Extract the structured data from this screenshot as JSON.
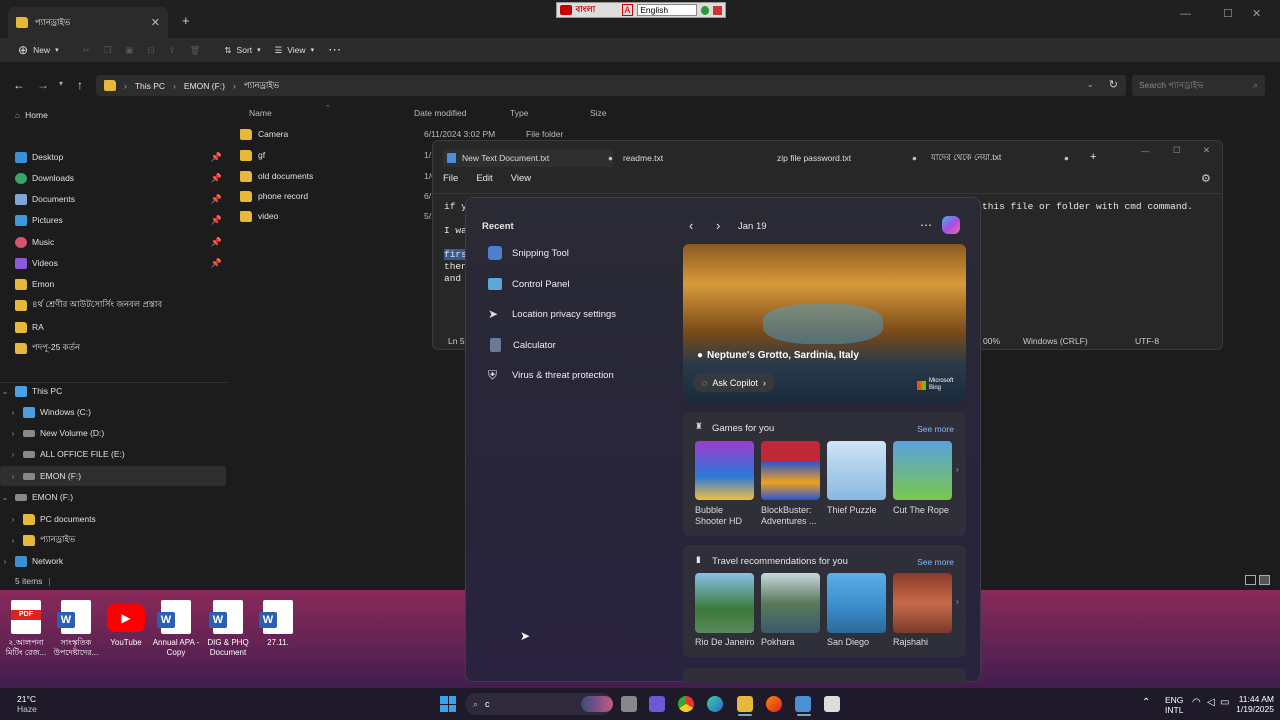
{
  "explorer": {
    "tab_title": "প্যানড্রাইভ",
    "toolbar": {
      "new": "New",
      "sort": "Sort",
      "view": "View"
    },
    "breadcrumb": [
      "This PC",
      "EMON (F:)",
      "প্যানড্রাইভ"
    ],
    "search_placeholder": "Search প্যানড্রাইভ",
    "nav": {
      "home": "Home",
      "quick": [
        "Desktop",
        "Downloads",
        "Documents",
        "Pictures",
        "Music",
        "Videos"
      ],
      "folders": [
        "Emon",
        "৪র্থ শ্রেণীর আউটসোর্সিং জনবল প্রস্তাব",
        "RA",
        "পদপূ-25 কর্তন"
      ],
      "this_pc": "This PC",
      "drives": [
        "Windows  (C:)",
        "New Volume (D:)",
        "ALL OFFICE FILE (E:)",
        "EMON (F:)"
      ],
      "emon_section": "EMON (F:)",
      "emon_children": [
        "PC documents",
        "প্যানড্রাইভ"
      ],
      "network": "Network"
    },
    "columns": {
      "name": "Name",
      "date": "Date modified",
      "type": "Type",
      "size": "Size"
    },
    "files": [
      {
        "name": "Camera",
        "date": "6/11/2024 3:02 PM",
        "type": "File folder"
      },
      {
        "name": "gf",
        "date": "1/19/"
      },
      {
        "name": "old documents",
        "date": "1/6/2"
      },
      {
        "name": "phone record",
        "date": "6/13/"
      },
      {
        "name": "video",
        "date": "5/16/"
      }
    ],
    "status": "5 items"
  },
  "notepad": {
    "tabs": [
      "New Text Document.txt",
      "readme.txt",
      "zip file password.txt",
      "যাদের থেকে নেয়া.txt"
    ],
    "menu": [
      "File",
      "Edit",
      "View"
    ],
    "lines": [
      "if y",
      "I wa",
      "firs",
      "then",
      "and "
    ],
    "line_right": "this file or folder with cmd command.",
    "status": {
      "pos": "Ln 5,",
      "zoom": "00%",
      "eol": "Windows (CRLF)",
      "enc": "UTF-8"
    }
  },
  "langbar": {
    "label": "বাংলা",
    "lang": "English"
  },
  "flyout": {
    "recent_title": "Recent",
    "recent": [
      "Snipping Tool",
      "Control Panel",
      "Location privacy settings",
      "Calculator",
      "Virus & threat protection"
    ],
    "date": "Jan 19",
    "hero_location": "Neptune's Grotto, Sardinia, Italy",
    "ask": "Ask Copilot",
    "bing": "Microsoft Bing",
    "games_title": "Games for you",
    "see_more": "See more",
    "games": [
      "Bubble Shooter HD",
      "BlockBuster: Adventures ...",
      "Thief Puzzle",
      "Cut The Rope"
    ],
    "travel_title": "Travel recommendations for you",
    "travel": [
      "Rio De Janeiro",
      "Pokhara",
      "San Diego",
      "Rajshahi"
    ]
  },
  "desktop": [
    "২.আলপনা মিটিং রেজ...",
    "সাংস্কৃতিক উপদেষ্টাদের...",
    "YouTube",
    "Annual APA - Copy",
    "DIG & PHQ Document",
    "27.11."
  ],
  "taskbar": {
    "weather_temp": "21°C",
    "weather_desc": "Haze",
    "search_text": "c",
    "lang1": "ENG",
    "lang2": "INTL",
    "time": "11:44 AM",
    "date": "1/19/2025"
  }
}
